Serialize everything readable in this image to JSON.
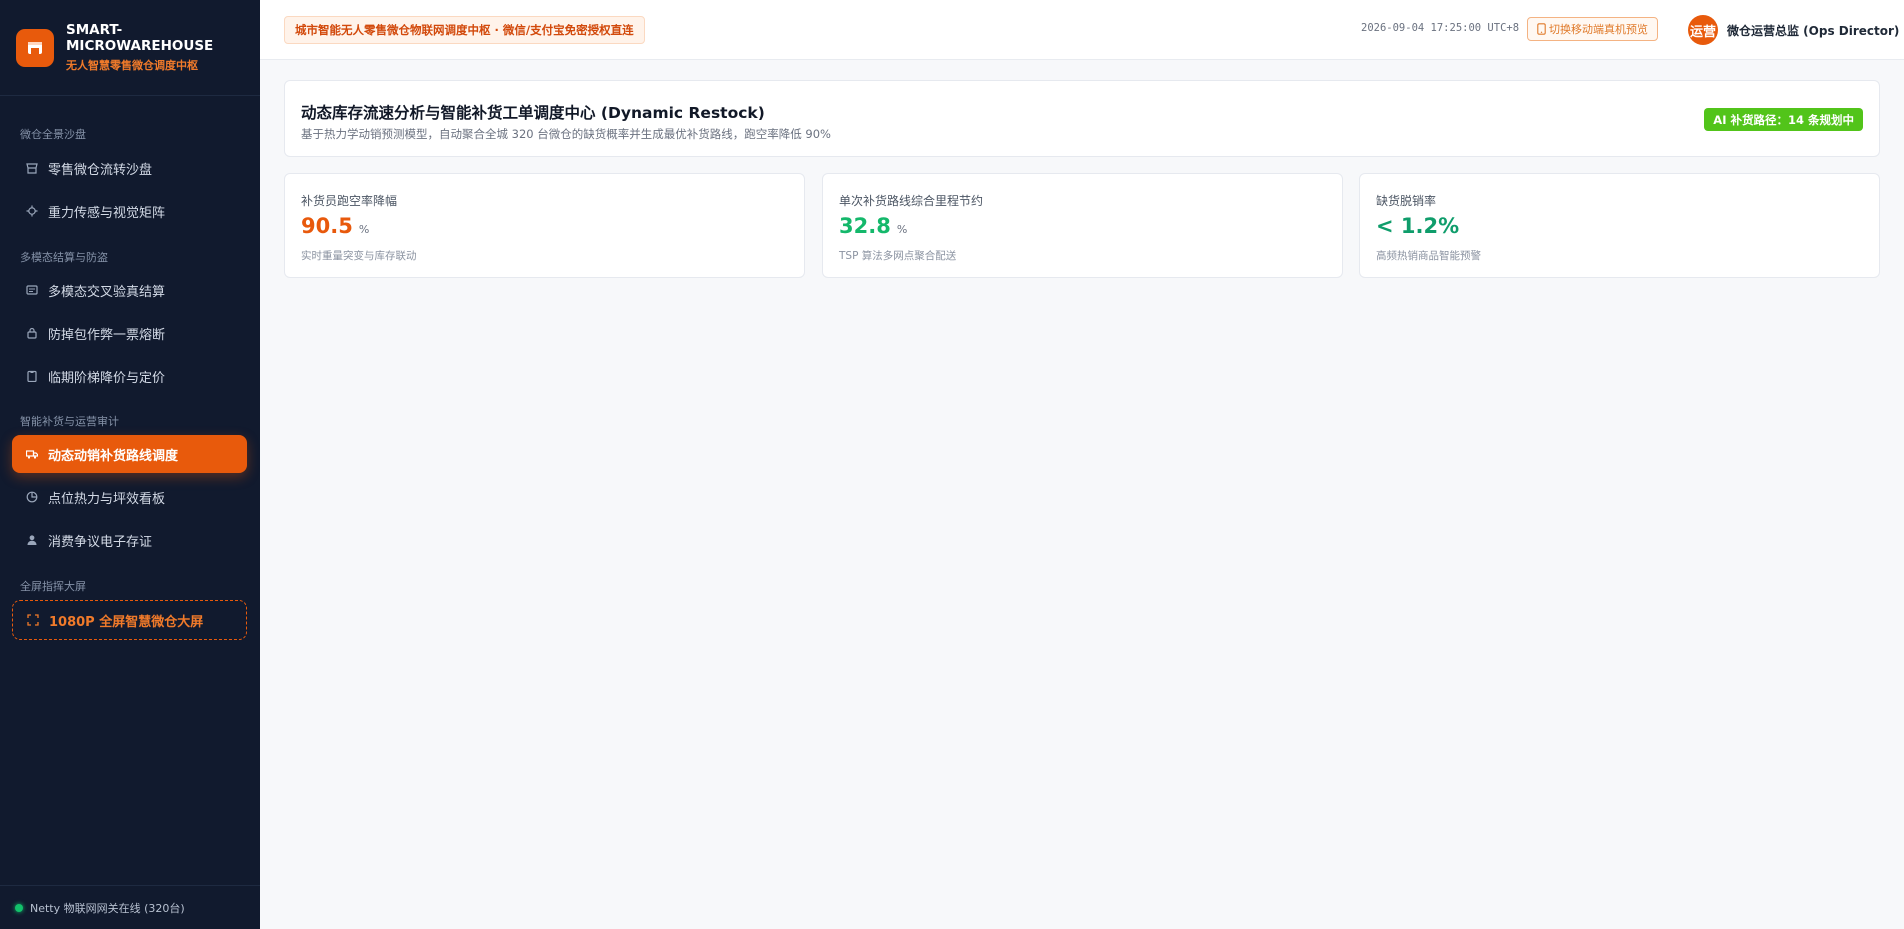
{
  "brand": {
    "title_line1": "SMART-",
    "title_line2": "MICROWAREHOUSE",
    "subtitle": "无人智慧零售微仓调度中枢"
  },
  "sidebar": {
    "groups": [
      {
        "title": "微仓全景沙盘"
      },
      {
        "title": "多模态结算与防盗"
      },
      {
        "title": "智能补货与运营审计"
      },
      {
        "title": "全屏指挥大屏"
      }
    ],
    "items": [
      {
        "label": "零售微仓流转沙盘",
        "icon": "store-icon"
      },
      {
        "label": "重力传感与视觉矩阵",
        "icon": "sensor-icon"
      },
      {
        "label": "多模态交叉验真结算",
        "icon": "verify-icon"
      },
      {
        "label": "防掉包作弊一票熔断",
        "icon": "lock-icon"
      },
      {
        "label": "临期阶梯降价与定价",
        "icon": "clipboard-icon"
      },
      {
        "label": "动态动销补货路线调度",
        "icon": "truck-icon",
        "active": true
      },
      {
        "label": "点位热力与坪效看板",
        "icon": "pie-chart-icon"
      },
      {
        "label": "消费争议电子存证",
        "icon": "user-icon"
      },
      {
        "label": "1080P 全屏智慧微仓大屏",
        "icon": "fullscreen-icon"
      }
    ],
    "footer": "Netty 物联网网关在线 (320台)"
  },
  "topbar": {
    "notice": "城市智能无人零售微仓物联网调度中枢 · 微信/支付宝免密授权直连",
    "timestamp": "2026-09-04 17:25:00 UTC+8",
    "mobile_preview": "切换移动端真机预览",
    "avatar_text": "运营",
    "user_name": "微仓运营总监 (Ops Director)"
  },
  "header": {
    "title": "动态库存流速分析与智能补货工单调度中心 (Dynamic Restock)",
    "subtitle": "基于热力学动销预测模型，自动聚合全城 320 台微仓的缺货概率并生成最优补货路线，跑空率降低 90%",
    "badge": "AI 补货路径：14 条规划中"
  },
  "kpis": [
    {
      "label": "补货员跑空率降幅",
      "value": "90.5",
      "unit": "%",
      "note": "实时重量突变与库存联动",
      "color": "#e8590c"
    },
    {
      "label": "单次补货路线综合里程节约",
      "value": "32.8",
      "unit": "%",
      "note": "TSP 算法多网点聚合配送",
      "color": "#14b86b"
    },
    {
      "label": "缺货脱销率",
      "value": "< 1.2%",
      "unit": "",
      "note": "高频热销商品智能预警",
      "color": "#0f9d6b"
    }
  ],
  "colors": {
    "accent": "#e85a0c",
    "sidebar_bg": "#111a2e",
    "success": "#52c41a"
  }
}
